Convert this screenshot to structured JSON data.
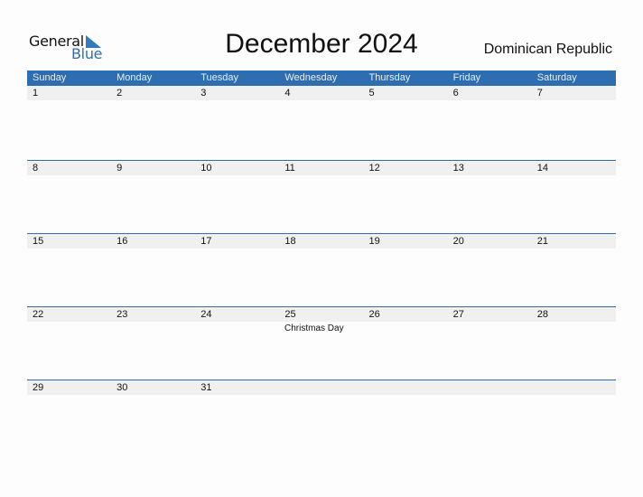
{
  "logo": {
    "line1": "General",
    "line2": "Blue",
    "accent_color": "#2f7bbd"
  },
  "title": "December 2024",
  "country": "Dominican Republic",
  "colors": {
    "header_bg": "#2e6db0",
    "date_row_bg": "#f0f0f0"
  },
  "weekdays": [
    "Sunday",
    "Monday",
    "Tuesday",
    "Wednesday",
    "Thursday",
    "Friday",
    "Saturday"
  ],
  "weeks": [
    [
      "1",
      "2",
      "3",
      "4",
      "5",
      "6",
      "7"
    ],
    [
      "8",
      "9",
      "10",
      "11",
      "12",
      "13",
      "14"
    ],
    [
      "15",
      "16",
      "17",
      "18",
      "19",
      "20",
      "21"
    ],
    [
      "22",
      "23",
      "24",
      "25",
      "26",
      "27",
      "28"
    ],
    [
      "29",
      "30",
      "31",
      "",
      "",
      "",
      ""
    ]
  ],
  "holidays": [
    {
      "date": "25",
      "name": "Christmas Day"
    }
  ]
}
